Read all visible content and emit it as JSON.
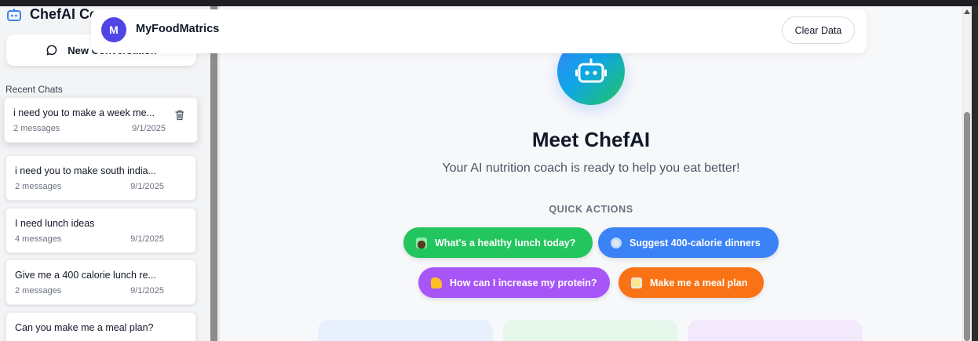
{
  "sidebar": {
    "brand_title": "ChefAI Co",
    "new_conversation_label": "New Conversation",
    "recent_chats_title": "Recent Chats",
    "chats": [
      {
        "title": "i need you to make a week me...",
        "messages": "2 messages",
        "date": "9/1/2025"
      },
      {
        "title": "i need you to make south india...",
        "messages": "2 messages",
        "date": "9/1/2025"
      },
      {
        "title": "I need lunch ideas",
        "messages": "4 messages",
        "date": "9/1/2025"
      },
      {
        "title": "Give me a 400 calorie lunch re...",
        "messages": "2 messages",
        "date": "9/1/2025"
      },
      {
        "title": "Can you make me a meal plan?",
        "messages": "",
        "date": ""
      }
    ]
  },
  "header": {
    "avatar_initial": "M",
    "app_name": "MyFoodMatrics",
    "clear_label": "Clear Data"
  },
  "hero": {
    "title": "Meet ChefAI",
    "subtitle": "Your AI nutrition coach is ready to help you eat better!"
  },
  "quick_actions": {
    "title": "QUICK ACTIONS",
    "items": [
      {
        "label": "What's a healthy lunch today?",
        "color": "#22c55e",
        "icon": "salad-icon"
      },
      {
        "label": "Suggest 400-calorie dinners",
        "color": "#3b82f6",
        "icon": "plate-icon"
      },
      {
        "label": "How can I increase my protein?",
        "color": "#a855f7",
        "icon": "flexed-arm-icon"
      },
      {
        "label": "Make me a meal plan",
        "color": "#f97316",
        "icon": "clipboard-icon"
      }
    ]
  }
}
